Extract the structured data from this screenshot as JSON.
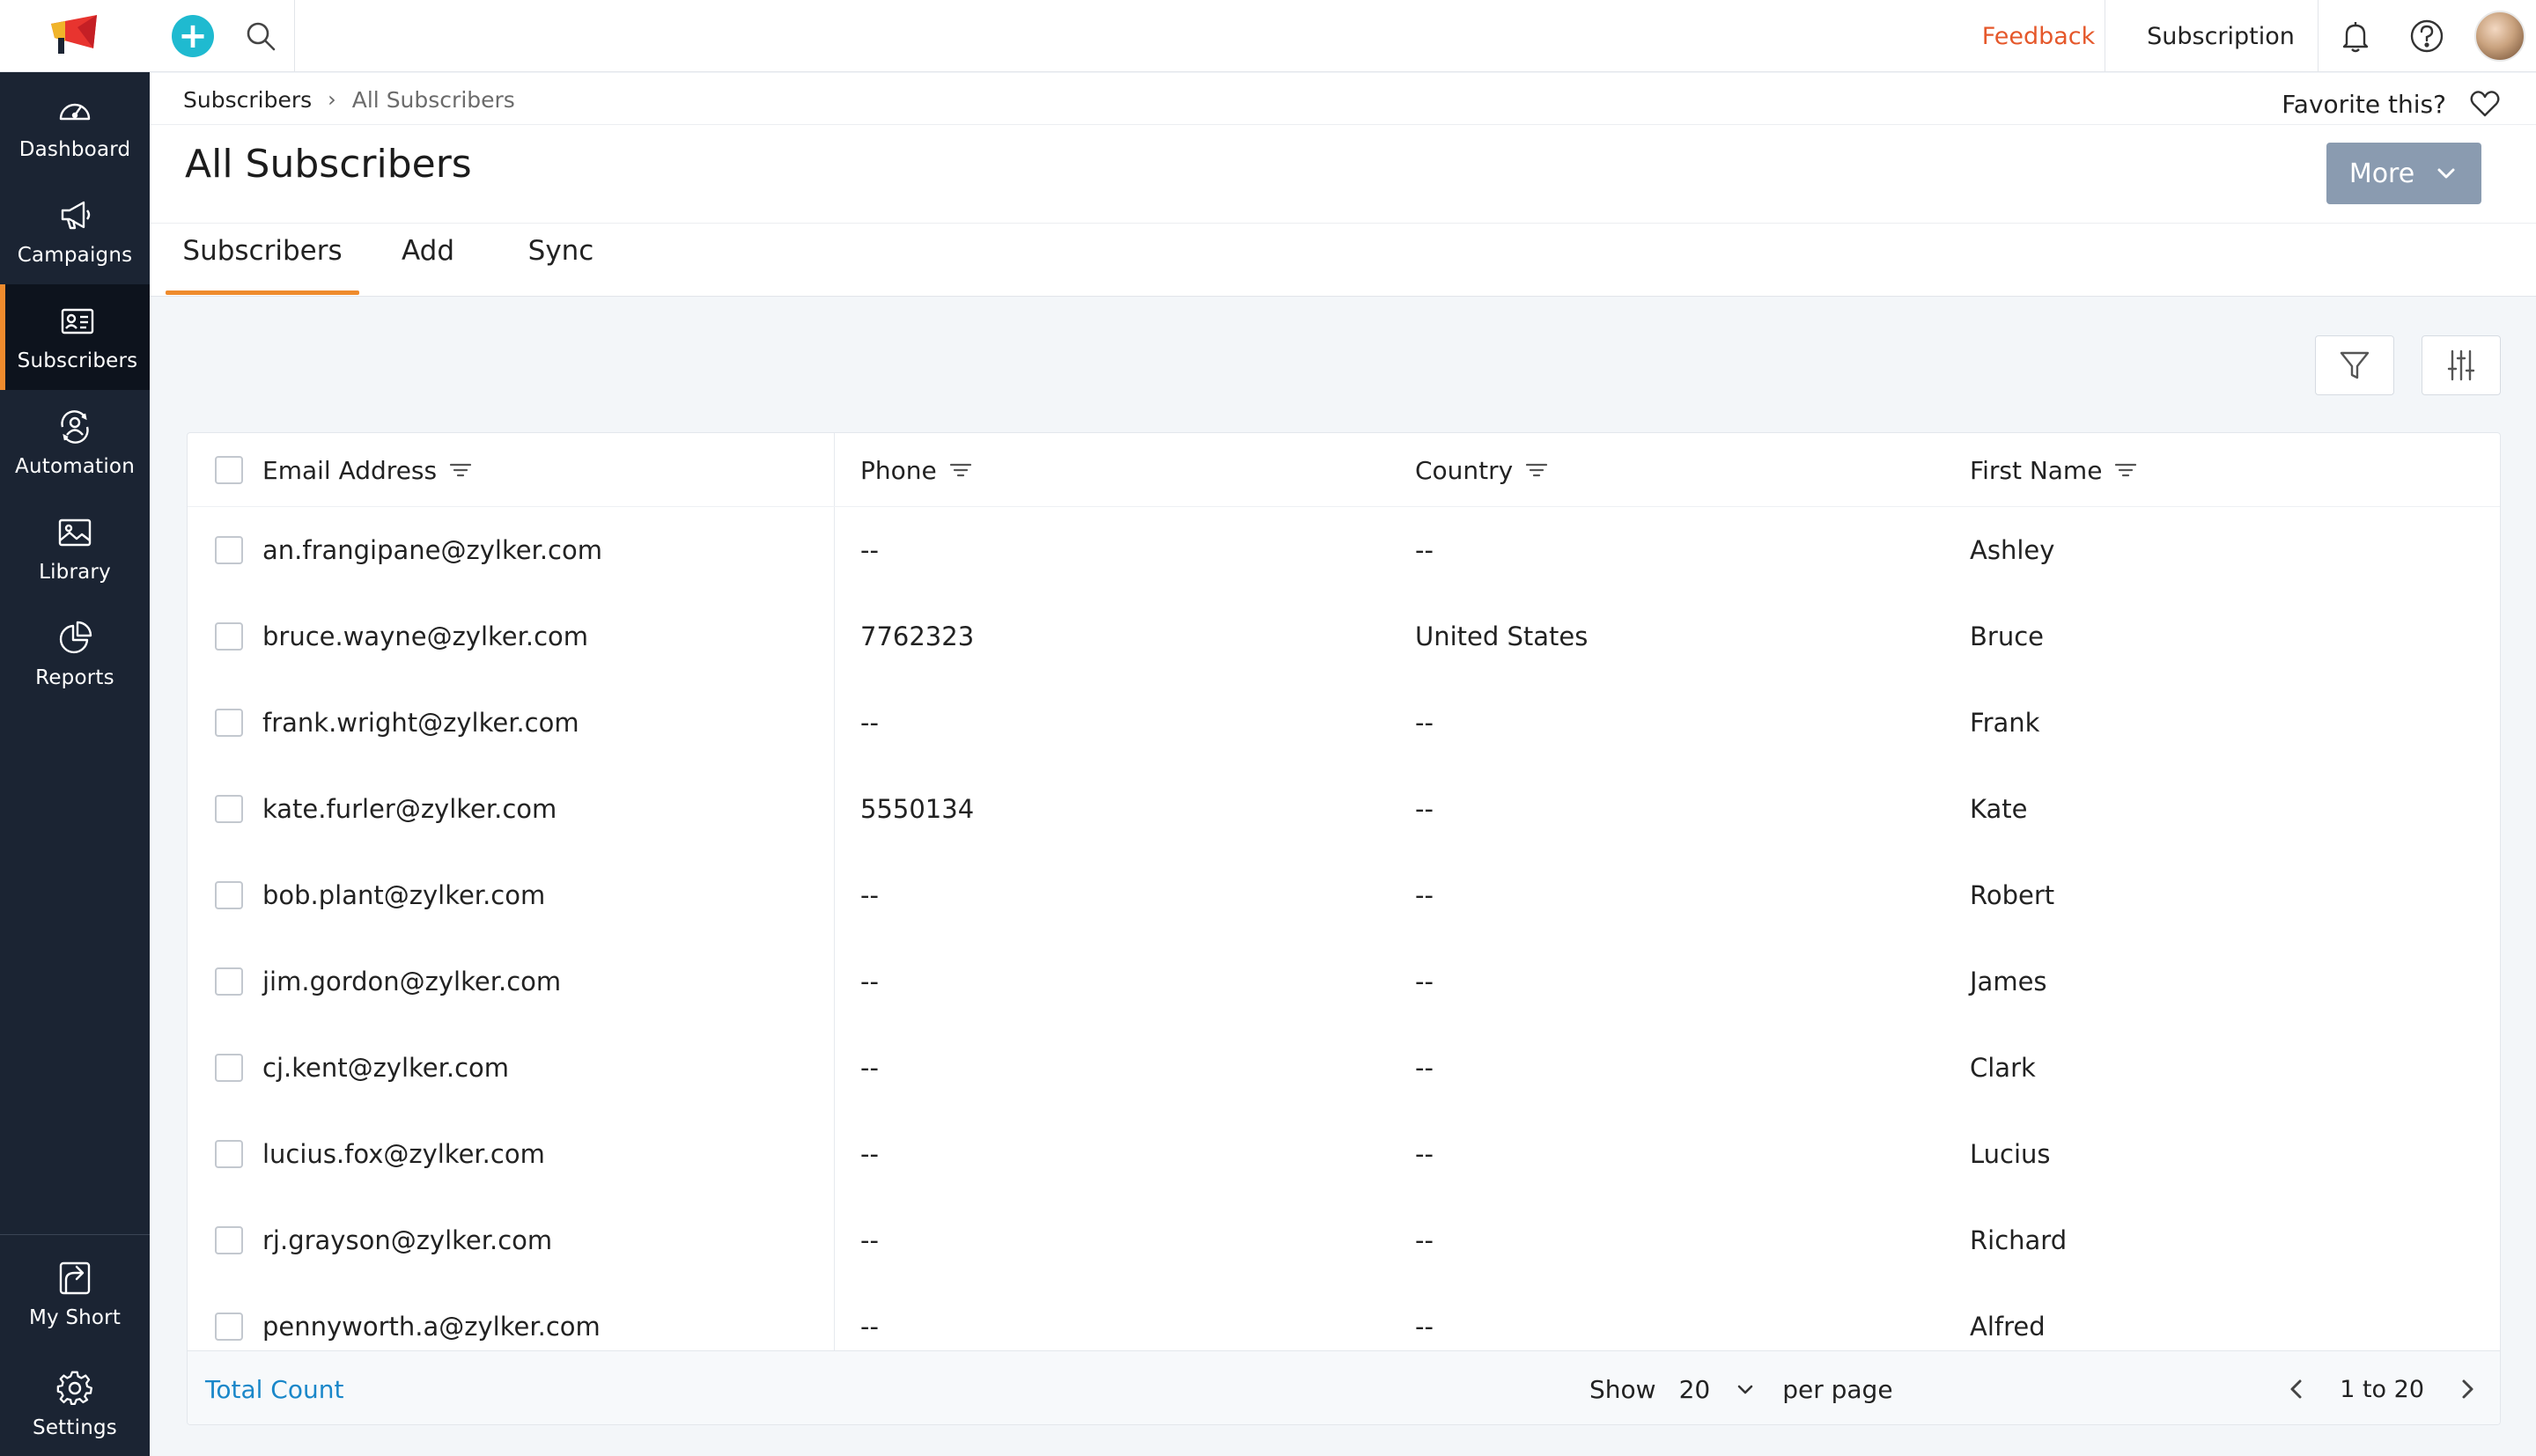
{
  "topbar": {
    "feedback_label": "Feedback",
    "subscription_label": "Subscription",
    "plus_symbol": "+"
  },
  "sidebar": {
    "items": [
      {
        "label": "Dashboard",
        "icon": "gauge-icon"
      },
      {
        "label": "Campaigns",
        "icon": "megaphone-icon"
      },
      {
        "label": "Subscribers",
        "icon": "contact-card-icon",
        "active": true
      },
      {
        "label": "Automation",
        "icon": "automation-icon"
      },
      {
        "label": "Library",
        "icon": "image-icon"
      },
      {
        "label": "Reports",
        "icon": "pie-chart-icon"
      }
    ],
    "bottom_items": [
      {
        "label": "My Short",
        "icon": "shortcut-icon"
      },
      {
        "label": "Settings",
        "icon": "gear-icon"
      }
    ]
  },
  "breadcrumb": {
    "parent": "Subscribers",
    "separator": "›",
    "current": "All Subscribers"
  },
  "header": {
    "favorite_label": "Favorite this?",
    "title": "All Subscribers",
    "more_label": "More"
  },
  "tabs": [
    {
      "label": "Subscribers",
      "active": true
    },
    {
      "label": "Add",
      "active": false
    },
    {
      "label": "Sync",
      "active": false
    }
  ],
  "table": {
    "columns": [
      "Email Address",
      "Phone",
      "Country",
      "First Name"
    ],
    "rows": [
      {
        "email": "an.frangipane@zylker.com",
        "phone": "--",
        "country": "--",
        "first_name": "Ashley"
      },
      {
        "email": "bruce.wayne@zylker.com",
        "phone": "7762323",
        "country": "United States",
        "first_name": "Bruce"
      },
      {
        "email": "frank.wright@zylker.com",
        "phone": "--",
        "country": "--",
        "first_name": "Frank"
      },
      {
        "email": "kate.furler@zylker.com",
        "phone": "5550134",
        "country": "--",
        "first_name": "Kate"
      },
      {
        "email": "bob.plant@zylker.com",
        "phone": "--",
        "country": "--",
        "first_name": "Robert"
      },
      {
        "email": "jim.gordon@zylker.com",
        "phone": "--",
        "country": "--",
        "first_name": "James"
      },
      {
        "email": "cj.kent@zylker.com",
        "phone": "--",
        "country": "--",
        "first_name": "Clark"
      },
      {
        "email": "lucius.fox@zylker.com",
        "phone": "--",
        "country": "--",
        "first_name": "Lucius"
      },
      {
        "email": "rj.grayson@zylker.com",
        "phone": "--",
        "country": "--",
        "first_name": "Richard"
      },
      {
        "email": "pennyworth.a@zylker.com",
        "phone": "--",
        "country": "--",
        "first_name": "Alfred"
      }
    ]
  },
  "footer": {
    "total_count_label": "Total Count",
    "show_label": "Show",
    "per_page_value": "20",
    "per_page_label": "per page",
    "range_label": "1 to 20"
  },
  "colors": {
    "sidebar_bg": "#1b2433",
    "active_accent": "#ef8b2d",
    "feedback": "#e5582b",
    "plus_button": "#1fbad0",
    "link": "#1a87c9",
    "more_button": "#8a9bb0"
  }
}
